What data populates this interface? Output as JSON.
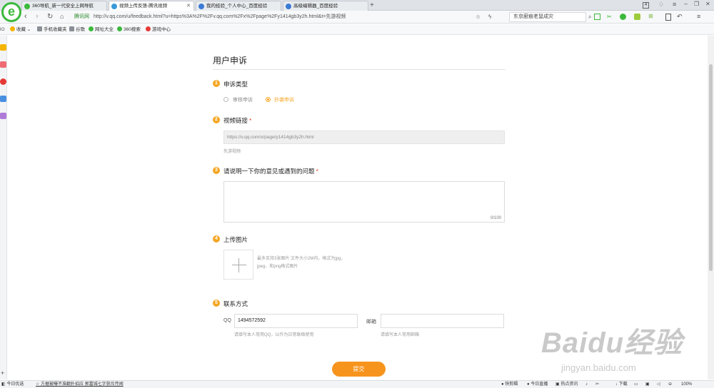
{
  "browser": {
    "tabs": [
      {
        "label": "360导航_新一代安全上网导航",
        "color": "#3cb93c",
        "active": false
      },
      {
        "label": "视频上传反馈-腾讯视频",
        "color": "#3a9ad9",
        "active": true
      },
      {
        "label": "我的经验_个人中心_百度经验",
        "color": "#3a7bd5",
        "active": false
      },
      {
        "label": "高级编辑器_百度经验",
        "color": "#3a7bd5",
        "active": false
      }
    ],
    "tab_count": "4",
    "address": {
      "site_label": "腾讯网",
      "url": "http://v.qq.com/u/feedback.html?u=https%3A%2F%2Fv.qq.com%2Fx%2Fpage%2Fy1414gb3y2h.html&t=先游视频"
    },
    "search_box": "东京廚痕老鼠成灾",
    "bookmarks": [
      {
        "label": "收藏",
        "color": "#f5b400"
      },
      {
        "label": "手机收藏夹",
        "color": "#8a8f96"
      },
      {
        "label": "谷歌",
        "color": "#8a8f96"
      },
      {
        "label": "网址大全",
        "color": "#3cb93c"
      },
      {
        "label": "360搜索",
        "color": "#3cb93c"
      },
      {
        "label": "游戏中心",
        "color": "#e53935"
      }
    ],
    "left_label": "lO",
    "status": {
      "left1": "今日优选",
      "news": "方据被曝不准翻扑招应 郭富城七字获斥传闻",
      "right": [
        "快剪辑",
        "今日直播",
        "热点资讯",
        "下载",
        "100%"
      ]
    }
  },
  "page": {
    "title": "用户申诉",
    "sections": [
      {
        "num": "1",
        "title": "申诉类型"
      },
      {
        "num": "2",
        "title": "视频链接",
        "required": "*"
      },
      {
        "num": "3",
        "title": "请说明一下你的意见或遇到的问题",
        "required": "*"
      },
      {
        "num": "4",
        "title": "上传图片"
      },
      {
        "num": "5",
        "title": "联系方式"
      }
    ],
    "appeal_types": [
      {
        "label": "审核申诉",
        "selected": false
      },
      {
        "label": "抄袭申诉",
        "selected": true
      }
    ],
    "video_url": "https://v.qq.com/x/page/y1414gb3y2h.html",
    "video_title": "先游视频",
    "textarea_counter": "0/100",
    "upload_hint_line1": "最多支持3张图片 文件大小2M内，格式为jpg，",
    "upload_hint_line2": "jpeg、和png格式图片",
    "contact": {
      "qq_label": "QQ",
      "qq_value": "1494572592",
      "qq_hint": "请填写本人常用QQ，以作为日常联络使用",
      "email_label": "邮箱",
      "email_value": "",
      "email_hint": "请填写本人常用邮箱"
    },
    "submit": "提交"
  },
  "watermark": {
    "big": "Baidu经验",
    "small": "jingyan.baidu.com"
  }
}
